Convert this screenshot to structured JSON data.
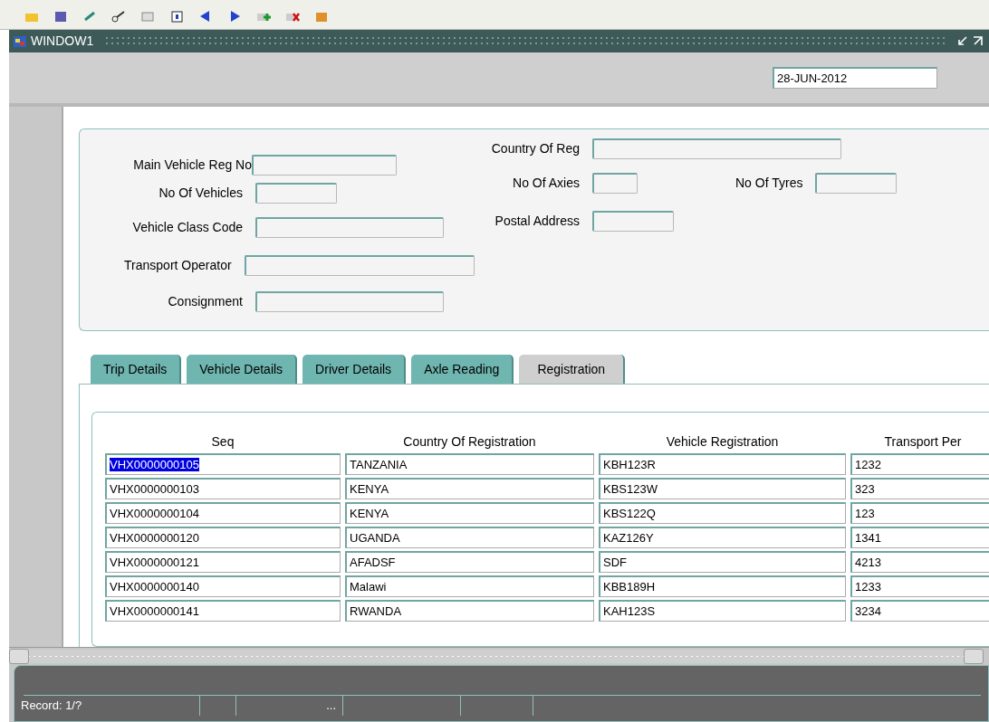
{
  "window": {
    "title": "WINDOW1"
  },
  "date": "28-JUN-2012",
  "form": {
    "fields": [
      {
        "label": "Main Vehicle Reg No"
      },
      {
        "label": "No Of Vehicles"
      },
      {
        "label": "Vehicle Class Code"
      },
      {
        "label": "Transport Operator"
      },
      {
        "label": "Consignment"
      },
      {
        "label": "Country Of Reg"
      },
      {
        "label": "No Of Axies"
      },
      {
        "label": "No Of Tyres"
      },
      {
        "label": "Postal Address"
      }
    ]
  },
  "tabs": [
    {
      "label": "Trip Details",
      "selected": false
    },
    {
      "label": "Vehicle Details",
      "selected": false
    },
    {
      "label": "Driver Details",
      "selected": false
    },
    {
      "label": "Axle Reading",
      "selected": false
    },
    {
      "label": "Registration",
      "selected": true
    }
  ],
  "table": {
    "columns": [
      "Seq",
      "Country Of Registration",
      "Vehicle Registration",
      "Transport Per"
    ],
    "rows": [
      {
        "cells": [
          "VHX0000000105",
          "TANZANIA",
          "KBH123R",
          "1232"
        ],
        "selected": true
      },
      {
        "cells": [
          "VHX0000000103",
          "KENYA",
          "KBS123W",
          "323"
        ],
        "selected": false
      },
      {
        "cells": [
          "VHX0000000104",
          "KENYA",
          "KBS122Q",
          "123"
        ],
        "selected": false
      },
      {
        "cells": [
          "VHX0000000120",
          "UGANDA",
          "KAZ126Y",
          "1341"
        ],
        "selected": false
      },
      {
        "cells": [
          "VHX0000000121",
          "AFADSF",
          "SDF",
          "4213"
        ],
        "selected": false
      },
      {
        "cells": [
          "VHX0000000140",
          "Malawi",
          "KBB189H",
          "1233"
        ],
        "selected": false
      },
      {
        "cells": [
          "VHX0000000141",
          "RWANDA",
          "KAH123S",
          "3234"
        ],
        "selected": false
      }
    ]
  },
  "status_bar": {
    "record": "Record: 1/?",
    "ellipsis": "..."
  }
}
